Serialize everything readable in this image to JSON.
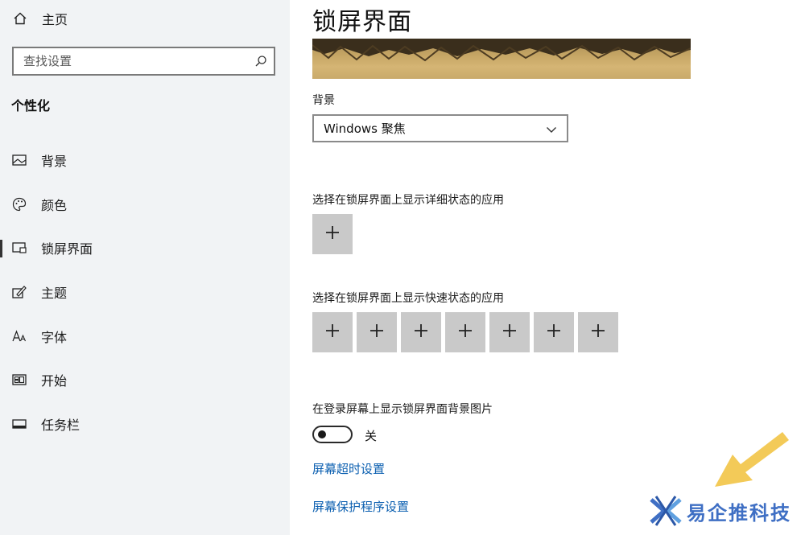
{
  "sidebar": {
    "home_label": "主页",
    "search": {
      "placeholder": "查找设置",
      "value": ""
    },
    "section_title": "个性化",
    "items": [
      {
        "label": "背景",
        "icon": "image-icon"
      },
      {
        "label": "颜色",
        "icon": "palette-icon"
      },
      {
        "label": "锁屏界面",
        "icon": "lock-screen-icon",
        "active": true
      },
      {
        "label": "主题",
        "icon": "theme-brush-icon"
      },
      {
        "label": "字体",
        "icon": "font-icon"
      },
      {
        "label": "开始",
        "icon": "start-menu-icon"
      },
      {
        "label": "任务栏",
        "icon": "taskbar-icon"
      }
    ]
  },
  "main": {
    "title": "锁屏界面",
    "background_label": "背景",
    "background_value": "Windows 聚焦",
    "detailed_status_label": "选择在锁屏界面上显示详细状态的应用",
    "quick_status_label": "选择在锁屏界面上显示快速状态的应用",
    "quick_status_count": 7,
    "signin_bg_label": "在登录屏幕上显示锁屏界面背景图片",
    "toggle_state": "关",
    "timeout_link": "屏幕超时设置",
    "screensaver_link": "屏幕保护程序设置"
  },
  "watermark": {
    "text": "易企推科技"
  },
  "colors": {
    "sidebar_bg": "#f1f3f5",
    "link": "#0b5fb0",
    "plus_tile": "#c9c9c9",
    "arrow": "#f2c64a",
    "watermark": "#3f6fc4"
  }
}
